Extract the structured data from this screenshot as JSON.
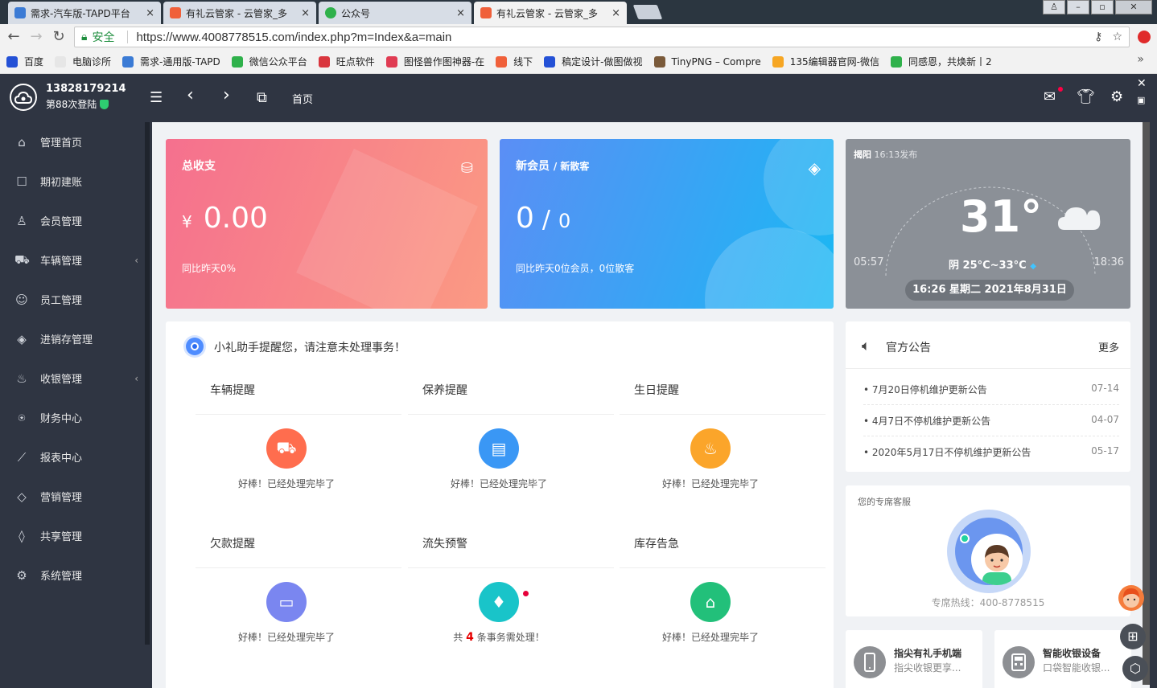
{
  "browser": {
    "tabs": [
      {
        "title": "需求-汽车版-TAPD平台",
        "color": "#3b7bd5"
      },
      {
        "title": "有礼云管家 - 云管家_多",
        "color": "#f0603a"
      },
      {
        "title": "公众号",
        "color": "#2fb14b"
      },
      {
        "title": "有礼云管家 - 云管家_多",
        "color": "#f0603a"
      }
    ],
    "tab_close": "×",
    "secure_label": "安全",
    "url": "https://www.4008778515.com/index.php?m=Index&a=main",
    "bookmarks": [
      {
        "label": "百度",
        "color": "#2451d6"
      },
      {
        "label": "电脑诊所",
        "color": "#e6e6e6"
      },
      {
        "label": "需求-通用版-TAPD",
        "color": "#3b7bd5"
      },
      {
        "label": "微信公众平台",
        "color": "#2fb14b"
      },
      {
        "label": "旺点软件",
        "color": "#d9363e"
      },
      {
        "label": "图怪兽作图神器-在",
        "color": "#e03b52"
      },
      {
        "label": "线下",
        "color": "#f0603a"
      },
      {
        "label": "稿定设计-做图做视",
        "color": "#2451d6"
      },
      {
        "label": "TinyPNG – Compre",
        "color": "#7a5a3a"
      },
      {
        "label": "135编辑器官网-微信",
        "color": "#f6a623"
      },
      {
        "label": "同感恩，共焕新丨2",
        "color": "#2fb14b"
      }
    ],
    "bookmarks_more": "»"
  },
  "header": {
    "username": "13828179214",
    "login_count": "第88次登陆",
    "home_tab": "首页"
  },
  "sidebar": {
    "items": [
      {
        "label": "管理首页",
        "icon": "⌂",
        "arrow": ""
      },
      {
        "label": "期初建账",
        "icon": "☐",
        "arrow": ""
      },
      {
        "label": "会员管理",
        "icon": "♙",
        "arrow": ""
      },
      {
        "label": "车辆管理",
        "icon": "⛟",
        "arrow": "‹"
      },
      {
        "label": "员工管理",
        "icon": "☺",
        "arrow": ""
      },
      {
        "label": "进销存管理",
        "icon": "◈",
        "arrow": ""
      },
      {
        "label": "收银管理",
        "icon": "♨",
        "arrow": "‹"
      },
      {
        "label": "财务中心",
        "icon": "⍟",
        "arrow": ""
      },
      {
        "label": "报表中心",
        "icon": "⟋",
        "arrow": ""
      },
      {
        "label": "营销管理",
        "icon": "◇",
        "arrow": ""
      },
      {
        "label": "共享管理",
        "icon": "◊",
        "arrow": ""
      },
      {
        "label": "系统管理",
        "icon": "⚙",
        "arrow": ""
      }
    ]
  },
  "cards": {
    "revenue": {
      "title": "总收支",
      "currency": "¥",
      "amount": "0.00",
      "compare": "同比昨天0%"
    },
    "members": {
      "title": "新会员",
      "title_sub": "/ 新散客",
      "value_a": "0",
      "sep": "/",
      "value_b": "0",
      "compare": "同比昨天0位会员，0位散客"
    },
    "weather": {
      "city": "揭阳",
      "published": "16:13发布",
      "temp": "31°",
      "sunrise": "05:57",
      "sunset": "18:36",
      "condition": "阴 25°C~33°C",
      "datetime": "16:26 星期二 2021年8月31日"
    }
  },
  "reminders": {
    "header": "小礼助手提醒您，请注意未处理事务！",
    "items": [
      {
        "title": "车辆提醒",
        "pre": "",
        "count": "",
        "text": "好棒！已经处理完毕了",
        "color": "#ff6d4e",
        "icon": "⛟"
      },
      {
        "title": "保养提醒",
        "pre": "",
        "count": "",
        "text": "好棒！已经处理完毕了",
        "color": "#3a97f5",
        "icon": "▤"
      },
      {
        "title": "生日提醒",
        "pre": "",
        "count": "",
        "text": "好棒！已经处理完毕了",
        "color": "#fba52a",
        "icon": "♨"
      },
      {
        "title": "欠款提醒",
        "pre": "",
        "count": "",
        "text": "好棒！已经处理完毕了",
        "color": "#7a86f0",
        "icon": "▭"
      },
      {
        "title": "流失预警",
        "pre": "共 ",
        "count": "4",
        "text": " 条事务需处理！",
        "color": "#19c4c9",
        "icon": "♦"
      },
      {
        "title": "库存告急",
        "pre": "",
        "count": "",
        "text": "好棒！已经处理完毕了",
        "color": "#22c07a",
        "icon": "⌂"
      }
    ]
  },
  "notices": {
    "title": "官方公告",
    "more": "更多",
    "items": [
      {
        "text": "7月20日停机维护更新公告",
        "date": "07-14"
      },
      {
        "text": "4月7日不停机维护更新公告",
        "date": "04-07"
      },
      {
        "text": "2020年5月17日不停机维护更新公告",
        "date": "05-17"
      }
    ]
  },
  "service": {
    "title": "您的专席客服",
    "hotline": "专席热线：400-8778515"
  },
  "devices": [
    {
      "title": "指尖有礼手机端",
      "sub": "指尖收银更享..."
    },
    {
      "title": "智能收银设备",
      "sub": "口袋智能收银..."
    }
  ]
}
